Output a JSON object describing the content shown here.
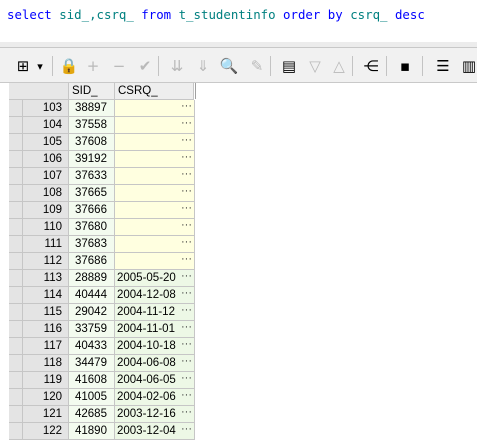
{
  "editor": {
    "sql_tokens": [
      {
        "t": "select",
        "k": "kw"
      },
      {
        "t": " sid_,csrq_ ",
        "k": "id"
      },
      {
        "t": "from",
        "k": "kw"
      },
      {
        "t": " t_studentinfo ",
        "k": "id"
      },
      {
        "t": "order by",
        "k": "kw"
      },
      {
        "t": " csrq_ ",
        "k": "id"
      },
      {
        "t": "desc",
        "k": "kw"
      }
    ]
  },
  "toolbar": {
    "buttons": [
      {
        "name": "grid-view-icon",
        "glyph": "⊞",
        "disabled": false
      },
      {
        "name": "dropdown-arrow-icon",
        "glyph": "▾",
        "disabled": false
      },
      {
        "name": "lock-icon",
        "glyph": "🔒",
        "disabled": false
      },
      {
        "name": "add-record-icon",
        "glyph": "+",
        "disabled": true
      },
      {
        "name": "delete-record-icon",
        "glyph": "−",
        "disabled": true
      },
      {
        "name": "post-changes-icon",
        "glyph": "✔",
        "disabled": true
      },
      {
        "name": "fetch-next-icon",
        "glyph": "⇊",
        "disabled": true
      },
      {
        "name": "fetch-last-icon",
        "glyph": "⇓",
        "disabled": true
      },
      {
        "name": "find-binoculars-icon",
        "glyph": "🔍",
        "disabled": false
      },
      {
        "name": "clear-eraser-icon",
        "glyph": "✎",
        "disabled": true
      },
      {
        "name": "query-by-example-icon",
        "glyph": "▤",
        "disabled": false
      },
      {
        "name": "filter-down-icon",
        "glyph": "▽",
        "disabled": true
      },
      {
        "name": "filter-up-icon",
        "glyph": "△",
        "disabled": true
      },
      {
        "name": "tree-view-icon",
        "glyph": "⋲",
        "disabled": false
      },
      {
        "name": "save-icon",
        "glyph": "▪",
        "disabled": false
      },
      {
        "name": "export-icon",
        "glyph": "☰",
        "disabled": false
      },
      {
        "name": "chart-icon",
        "glyph": "▥",
        "disabled": false
      }
    ]
  },
  "grid": {
    "columns": [
      "SID_",
      "CSRQ_"
    ],
    "cell_button": "···",
    "rows": [
      {
        "n": "103",
        "sid": "38897",
        "csrq": ""
      },
      {
        "n": "104",
        "sid": "37558",
        "csrq": ""
      },
      {
        "n": "105",
        "sid": "37608",
        "csrq": ""
      },
      {
        "n": "106",
        "sid": "39192",
        "csrq": ""
      },
      {
        "n": "107",
        "sid": "37633",
        "csrq": ""
      },
      {
        "n": "108",
        "sid": "37665",
        "csrq": ""
      },
      {
        "n": "109",
        "sid": "37666",
        "csrq": ""
      },
      {
        "n": "110",
        "sid": "37680",
        "csrq": ""
      },
      {
        "n": "111",
        "sid": "37683",
        "csrq": ""
      },
      {
        "n": "112",
        "sid": "37686",
        "csrq": ""
      },
      {
        "n": "113",
        "sid": "28889",
        "csrq": "2005-05-20"
      },
      {
        "n": "114",
        "sid": "40444",
        "csrq": "2004-12-08"
      },
      {
        "n": "115",
        "sid": "29042",
        "csrq": "2004-11-12"
      },
      {
        "n": "116",
        "sid": "33759",
        "csrq": "2004-11-01"
      },
      {
        "n": "117",
        "sid": "40433",
        "csrq": "2004-10-18"
      },
      {
        "n": "118",
        "sid": "34479",
        "csrq": "2004-06-08"
      },
      {
        "n": "119",
        "sid": "41608",
        "csrq": "2004-06-05"
      },
      {
        "n": "120",
        "sid": "41005",
        "csrq": "2004-02-06"
      },
      {
        "n": "121",
        "sid": "42685",
        "csrq": "2003-12-16"
      },
      {
        "n": "122",
        "sid": "41890",
        "csrq": "2003-12-04"
      }
    ]
  }
}
